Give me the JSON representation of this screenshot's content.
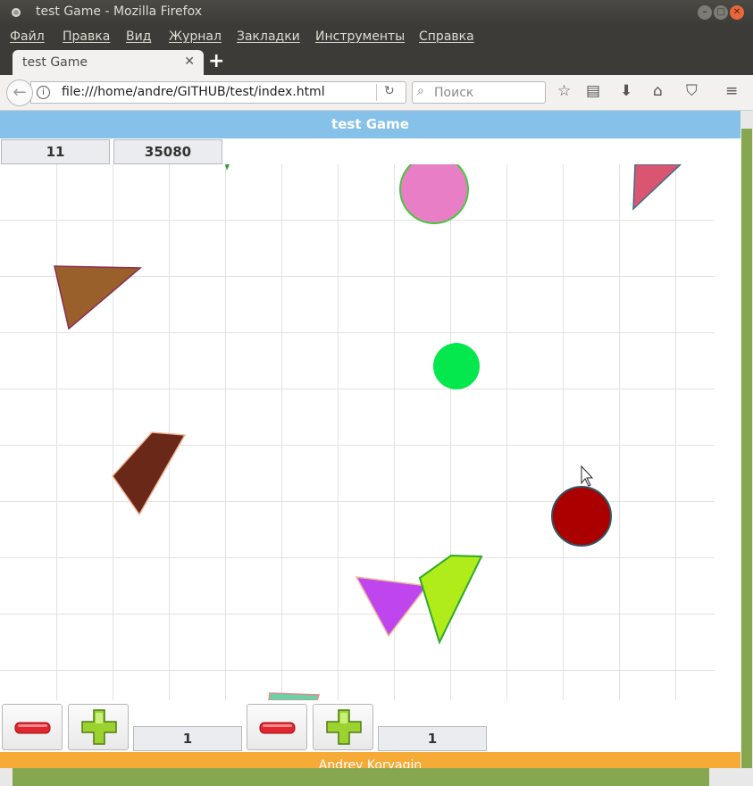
{
  "window": {
    "title": "test Game - Mozilla Firefox"
  },
  "menu": {
    "items": [
      "Файл",
      "Правка",
      "Вид",
      "Журнал",
      "Закладки",
      "Инструменты",
      "Справка"
    ]
  },
  "tab": {
    "title": "test Game",
    "close": "✕",
    "new": "+"
  },
  "nav": {
    "url": "file:///home/andre/GITHUB/test/index.html",
    "search_placeholder": "Поиск"
  },
  "page": {
    "header": "test Game",
    "stat_left": "11",
    "stat_right": "35080",
    "controls": {
      "value_a": "1",
      "value_b": "1"
    },
    "footer": "Andrey Koryagin"
  },
  "colors": {
    "header": "#85c1e9",
    "footer": "#f5ab35",
    "scroll_thumb": "#86a750"
  },
  "icons": [
    "back-arrow-icon",
    "info-icon",
    "reload-icon",
    "search-icon",
    "bookmark-star-icon",
    "reading-list-icon",
    "download-icon",
    "home-icon",
    "pocket-icon",
    "hamburger-menu-icon",
    "minus-icon",
    "plus-icon"
  ]
}
